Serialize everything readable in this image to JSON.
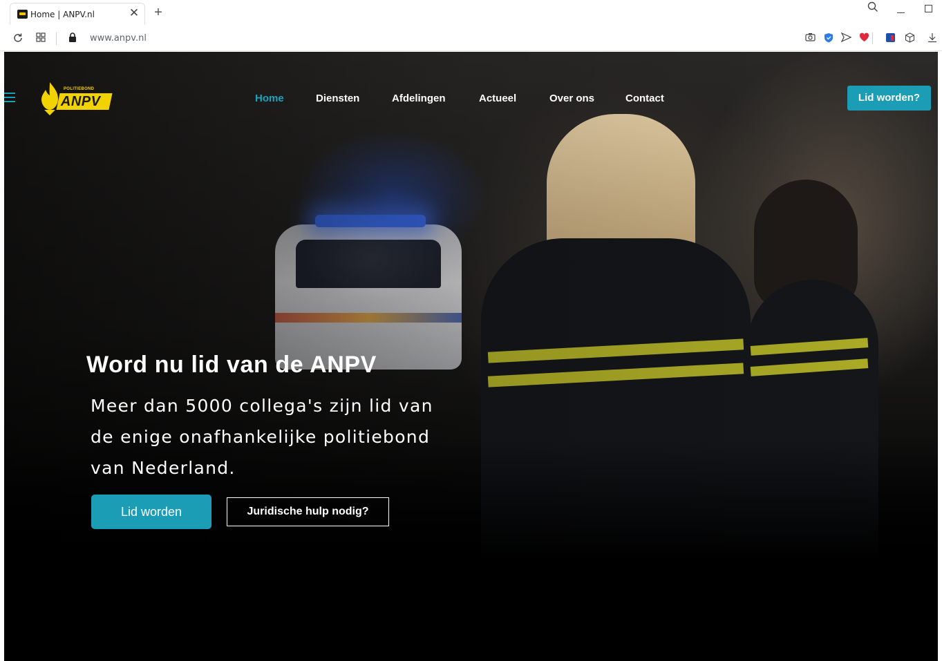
{
  "browser": {
    "tab_title": "Home | ANPV.nl",
    "tab_close": "✕",
    "new_tab": "+",
    "url": "www.anpv.nl"
  },
  "icons": {
    "reload": "reload-icon",
    "speed_dial": "grid-icon",
    "lock": "lock-icon",
    "extensions": [
      "camera-icon",
      "shield-icon",
      "send-icon",
      "heart-icon",
      "bookmark-icon",
      "cube-icon",
      "download-icon"
    ]
  },
  "logo": {
    "small_text": "POLITIEBOND",
    "name": "ANPV"
  },
  "nav": {
    "items": [
      {
        "label": "Home",
        "active": true
      },
      {
        "label": "Diensten",
        "active": false
      },
      {
        "label": "Afdelingen",
        "active": false
      },
      {
        "label": "Actueel",
        "active": false
      },
      {
        "label": "Over ons",
        "active": false
      },
      {
        "label": "Contact",
        "active": false
      }
    ],
    "cta": "Lid worden?"
  },
  "hero": {
    "title": "Word nu lid van de ANPV",
    "subtitle_lines": [
      "Meer dan 5000 collega's zijn lid van",
      "de enige onafhankelijke politiebond",
      "van Nederland."
    ],
    "primary_button": "Lid worden",
    "secondary_button": "Juridische hulp nodig?"
  },
  "colors": {
    "accent": "#1a9db5",
    "logo_yellow": "#f2d200"
  }
}
